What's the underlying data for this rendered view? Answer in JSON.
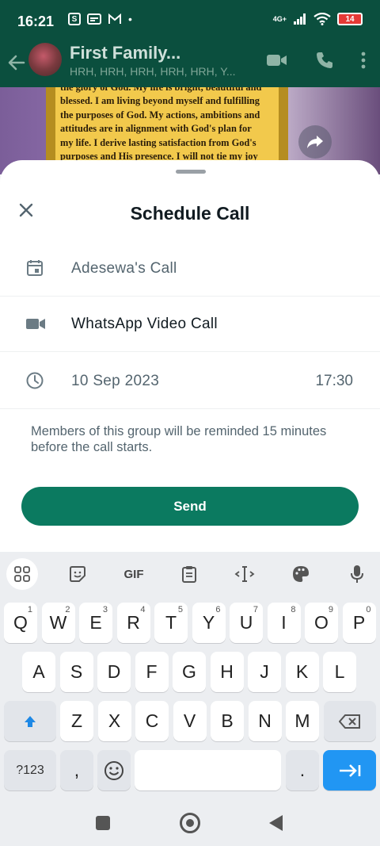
{
  "status_bar": {
    "time": "16:21",
    "app_icons": [
      "s-icon",
      "card-icon",
      "gmail-icon"
    ],
    "dot": "•",
    "network": "4G+",
    "battery": "14"
  },
  "chat": {
    "title": "First Family...",
    "subtitle": "HRH, HRH, HRH, HRH, HRH, Y...",
    "card_lines": [
      "the glory of God. My life is bright, beautiful and",
      "blessed. I am living beyond myself and fulfilling",
      "the purposes of God. My actions, ambitions and",
      "attitudes are in alignment with God's plan for",
      "my life. I derive lasting satisfaction from God's",
      "purposes and His presence. I will not tie my joy"
    ]
  },
  "sheet": {
    "title": "Schedule Call",
    "call_name": "Adesewa's Call",
    "call_type": "WhatsApp Video Call",
    "date": "10 Sep 2023",
    "time": "17:30",
    "note": "Members of this group will be reminded 15 minutes before the call starts.",
    "send_label": "Send"
  },
  "keyboard": {
    "toolbar": [
      "apps-icon",
      "sticker-icon",
      "GIF",
      "clipboard-icon",
      "cursor-icon",
      "palette-icon",
      "mic-icon"
    ],
    "gif_label": "GIF",
    "row1": [
      {
        "k": "Q",
        "h": "1"
      },
      {
        "k": "W",
        "h": "2"
      },
      {
        "k": "E",
        "h": "3"
      },
      {
        "k": "R",
        "h": "4"
      },
      {
        "k": "T",
        "h": "5"
      },
      {
        "k": "Y",
        "h": "6"
      },
      {
        "k": "U",
        "h": "7"
      },
      {
        "k": "I",
        "h": "8"
      },
      {
        "k": "O",
        "h": "9"
      },
      {
        "k": "P",
        "h": "0"
      }
    ],
    "row2": [
      "A",
      "S",
      "D",
      "F",
      "G",
      "H",
      "J",
      "K",
      "L"
    ],
    "row3": [
      "Z",
      "X",
      "C",
      "V",
      "B",
      "N",
      "M"
    ],
    "symbols_label": "?123",
    "comma": ",",
    "period": "."
  },
  "colors": {
    "header_green": "#0b4f3e",
    "send_green": "#0b7a60",
    "enter_blue": "#2196f3"
  }
}
